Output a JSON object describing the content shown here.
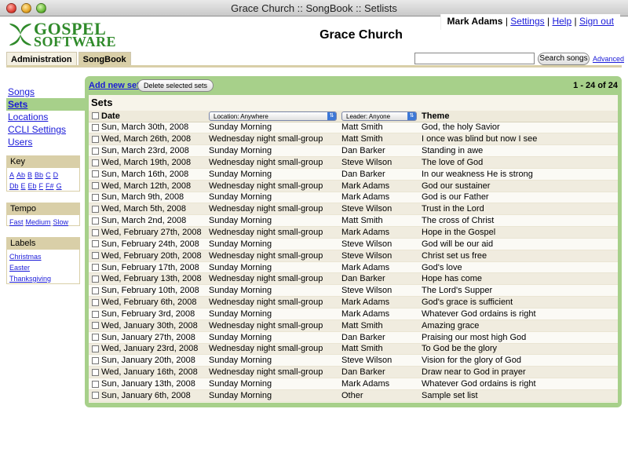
{
  "window": {
    "title": "Grace Church :: SongBook :: Setlists"
  },
  "logo": {
    "line1": "GOSPEL",
    "line2": "SOFTWARE"
  },
  "church_name": "Grace Church",
  "user": {
    "name": "Mark Adams",
    "settings": "Settings",
    "help": "Help",
    "signout": "Sign out",
    "sep": "|"
  },
  "tabs": [
    {
      "label": "Administration"
    },
    {
      "label": "SongBook"
    }
  ],
  "search": {
    "value": "",
    "button": "Search songs",
    "advanced": "Advanced"
  },
  "nav": [
    {
      "label": "Songs"
    },
    {
      "label": "Sets"
    },
    {
      "label": "Locations"
    },
    {
      "label": "CCLI Settings"
    },
    {
      "label": "Users"
    }
  ],
  "key_box": {
    "title": "Key",
    "row1": [
      "A",
      "Ab",
      "B",
      "Bb",
      "C",
      "D"
    ],
    "row2": [
      "Db",
      "E",
      "Eb",
      "F",
      "F#",
      "G"
    ]
  },
  "tempo_box": {
    "title": "Tempo",
    "items": [
      "Fast",
      "Medium",
      "Slow"
    ]
  },
  "labels_box": {
    "title": "Labels",
    "items": [
      "Christmas",
      "Easter",
      "Thanksgiving"
    ]
  },
  "panel": {
    "add_new_set": "Add new set",
    "delete_selected": "Delete selected sets",
    "pager": "1 - 24 of 24",
    "title": "Sets"
  },
  "columns": {
    "date": "Date",
    "location_filter": "Location: Anywhere",
    "leader_filter": "Leader: Anyone",
    "theme": "Theme"
  },
  "rows": [
    {
      "date": "Sun, March 30th, 2008",
      "location": "Sunday Morning",
      "leader": "Matt Smith",
      "theme": "God, the holy Savior"
    },
    {
      "date": "Wed, March 26th, 2008",
      "location": "Wednesday night small-group",
      "leader": "Matt Smith",
      "theme": "I once was blind but now I see"
    },
    {
      "date": "Sun, March 23rd, 2008",
      "location": "Sunday Morning",
      "leader": "Dan Barker",
      "theme": "Standing in awe"
    },
    {
      "date": "Wed, March 19th, 2008",
      "location": "Wednesday night small-group",
      "leader": "Steve Wilson",
      "theme": "The love of God"
    },
    {
      "date": "Sun, March 16th, 2008",
      "location": "Sunday Morning",
      "leader": "Dan Barker",
      "theme": "In our weakness He is strong"
    },
    {
      "date": "Wed, March 12th, 2008",
      "location": "Wednesday night small-group",
      "leader": "Mark Adams",
      "theme": "God our sustainer"
    },
    {
      "date": "Sun, March 9th, 2008",
      "location": "Sunday Morning",
      "leader": "Mark Adams",
      "theme": "God is our Father"
    },
    {
      "date": "Wed, March 5th, 2008",
      "location": "Wednesday night small-group",
      "leader": "Steve Wilson",
      "theme": "Trust in the Lord"
    },
    {
      "date": "Sun, March 2nd, 2008",
      "location": "Sunday Morning",
      "leader": "Matt Smith",
      "theme": "The cross of Christ"
    },
    {
      "date": "Wed, February 27th, 2008",
      "location": "Wednesday night small-group",
      "leader": "Mark Adams",
      "theme": "Hope in the Gospel"
    },
    {
      "date": "Sun, February 24th, 2008",
      "location": "Sunday Morning",
      "leader": "Steve Wilson",
      "theme": "God will be our aid"
    },
    {
      "date": "Wed, February 20th, 2008",
      "location": "Wednesday night small-group",
      "leader": "Steve Wilson",
      "theme": "Christ set us free"
    },
    {
      "date": "Sun, February 17th, 2008",
      "location": "Sunday Morning",
      "leader": "Mark Adams",
      "theme": "God's love"
    },
    {
      "date": "Wed, February 13th, 2008",
      "location": "Wednesday night small-group",
      "leader": "Dan Barker",
      "theme": "Hope has come"
    },
    {
      "date": "Sun, February 10th, 2008",
      "location": "Sunday Morning",
      "leader": "Steve Wilson",
      "theme": "The Lord's Supper"
    },
    {
      "date": "Wed, February 6th, 2008",
      "location": "Wednesday night small-group",
      "leader": "Mark Adams",
      "theme": "God's grace is sufficient"
    },
    {
      "date": "Sun, February 3rd, 2008",
      "location": "Sunday Morning",
      "leader": "Mark Adams",
      "theme": "Whatever God ordains is right"
    },
    {
      "date": "Wed, January 30th, 2008",
      "location": "Wednesday night small-group",
      "leader": "Matt Smith",
      "theme": "Amazing grace"
    },
    {
      "date": "Sun, January 27th, 2008",
      "location": "Sunday Morning",
      "leader": "Dan Barker",
      "theme": "Praising our most high God"
    },
    {
      "date": "Wed, January 23rd, 2008",
      "location": "Wednesday night small-group",
      "leader": "Matt Smith",
      "theme": "To God be the glory"
    },
    {
      "date": "Sun, January 20th, 2008",
      "location": "Sunday Morning",
      "leader": "Steve Wilson",
      "theme": "Vision for the glory of God"
    },
    {
      "date": "Wed, January 16th, 2008",
      "location": "Wednesday night small-group",
      "leader": "Dan Barker",
      "theme": "Draw near to God in prayer"
    },
    {
      "date": "Sun, January 13th, 2008",
      "location": "Sunday Morning",
      "leader": "Mark Adams",
      "theme": "Whatever God ordains is right"
    },
    {
      "date": "Sun, January 6th, 2008",
      "location": "Sunday Morning",
      "leader": "Other",
      "theme": "Sample set list"
    }
  ],
  "colors": {
    "green_panel": "#a7d08a",
    "tan": "#d9cfa8",
    "link": "#1a1ad8",
    "logo_green": "#2f8a2a"
  }
}
